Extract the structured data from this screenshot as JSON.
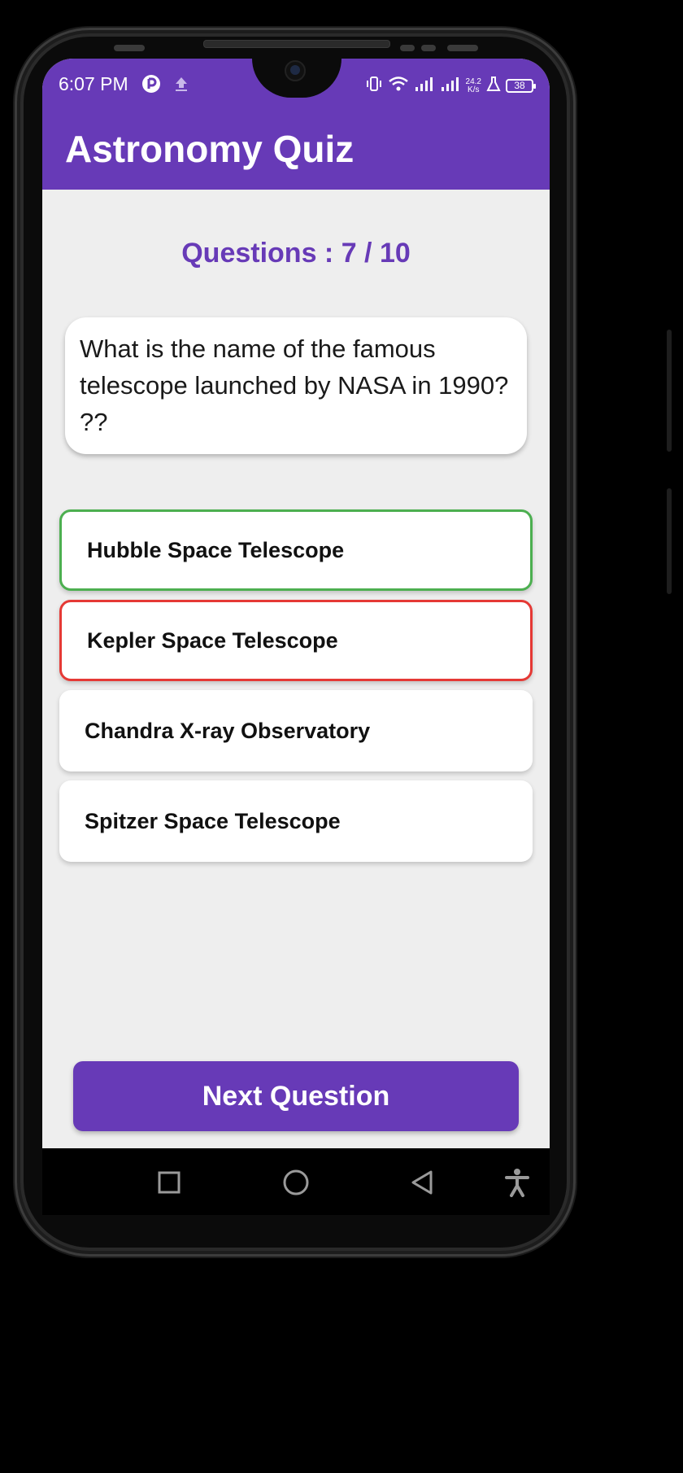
{
  "status_bar": {
    "time": "6:07 PM",
    "network_speed_value": "24.2",
    "network_speed_unit": "K/s",
    "battery_level": "38",
    "icons": [
      "vpn-icon",
      "upload-icon",
      "vibrate-icon",
      "wifi-icon",
      "signal-icon",
      "signal-icon",
      "lab-icon",
      "battery-icon"
    ]
  },
  "app_bar": {
    "title": "Astronomy Quiz",
    "background_color": "#673ab7"
  },
  "quiz": {
    "counter": "Questions : 7 / 10",
    "question": "What is the name of the famous telescope launched by NASA in 1990? ??",
    "options": [
      {
        "label": "Hubble Space Telescope",
        "state": "correct",
        "border_color": "#4caf50"
      },
      {
        "label": "Kepler Space Telescope",
        "state": "wrong",
        "border_color": "#e53935"
      },
      {
        "label": "Chandra X-ray Observatory",
        "state": "default"
      },
      {
        "label": "Spitzer Space Telescope",
        "state": "default"
      }
    ],
    "next_button": "Next Question"
  },
  "nav_bar": {
    "items": [
      "recents-square-icon",
      "home-circle-icon",
      "back-triangle-icon",
      "accessibility-icon"
    ]
  }
}
